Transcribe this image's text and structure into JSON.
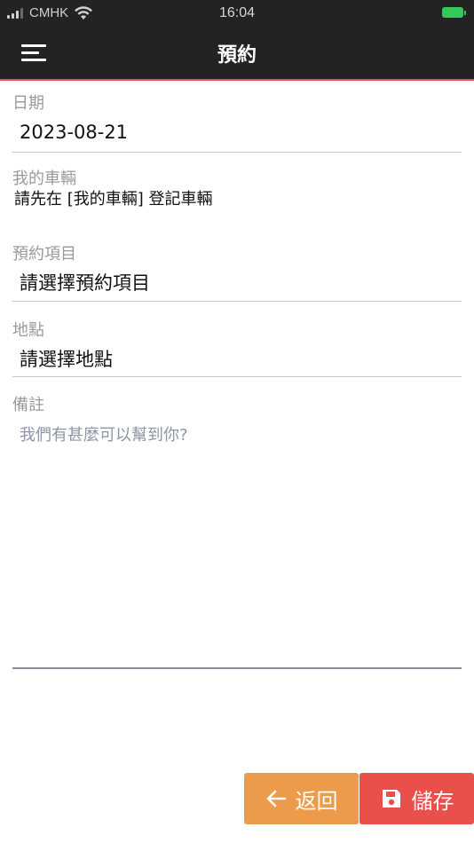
{
  "status_bar": {
    "carrier": "CMHK",
    "time": "16:04"
  },
  "header": {
    "title": "預約"
  },
  "form": {
    "date": {
      "label": "日期",
      "value": "2023-08-21"
    },
    "vehicle": {
      "label": "我的車輛",
      "message": "請先在 [我的車輛] 登記車輛"
    },
    "service_item": {
      "label": "預約項目",
      "value": "請選擇預約項目"
    },
    "location": {
      "label": "地點",
      "value": "請選擇地點"
    },
    "remarks": {
      "label": "備註",
      "placeholder": "我們有甚麼可以幫到你?"
    }
  },
  "actions": {
    "back_label": "返回",
    "save_label": "儲存"
  },
  "colors": {
    "header_bg": "#232323",
    "accent_red": "#e94f4b",
    "back_orange": "#ec9b4a",
    "battery_green": "#34c759"
  }
}
